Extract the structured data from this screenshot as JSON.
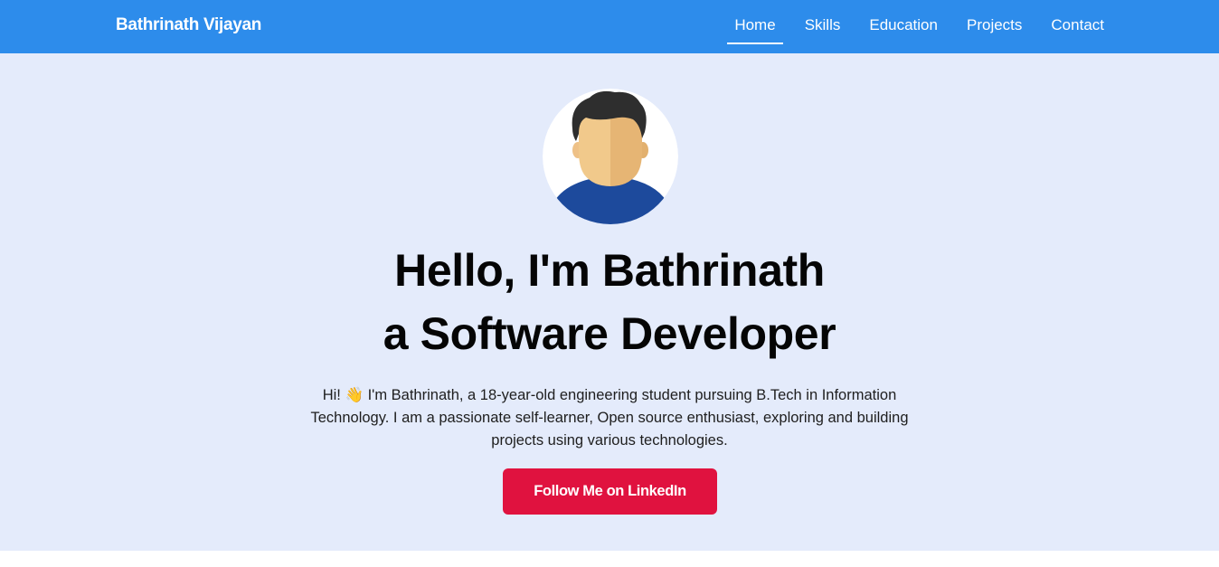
{
  "nav": {
    "brand": "Bathrinath Vijayan",
    "links": [
      {
        "label": "Home",
        "active": true
      },
      {
        "label": "Skills"
      },
      {
        "label": "Education"
      },
      {
        "label": "Projects"
      },
      {
        "label": "Contact"
      }
    ]
  },
  "hero": {
    "avatar_icon": "person-avatar-icon",
    "headline_line1": "Hello, I'm Bathrinath",
    "headline_line2": "a Software Developer",
    "bio": "Hi! 👋 I'm Bathrinath, a 18-year-old engineering student pursuing B.Tech in Information Technology. I am a passionate self-learner, Open source enthusiast, exploring and building projects using various technologies.",
    "cta_label": "Follow Me on LinkedIn"
  },
  "colors": {
    "navbar_bg": "#2d8ceb",
    "hero_bg": "#e4ebfb",
    "cta_bg": "#e0123f",
    "text_dark": "#050505"
  }
}
